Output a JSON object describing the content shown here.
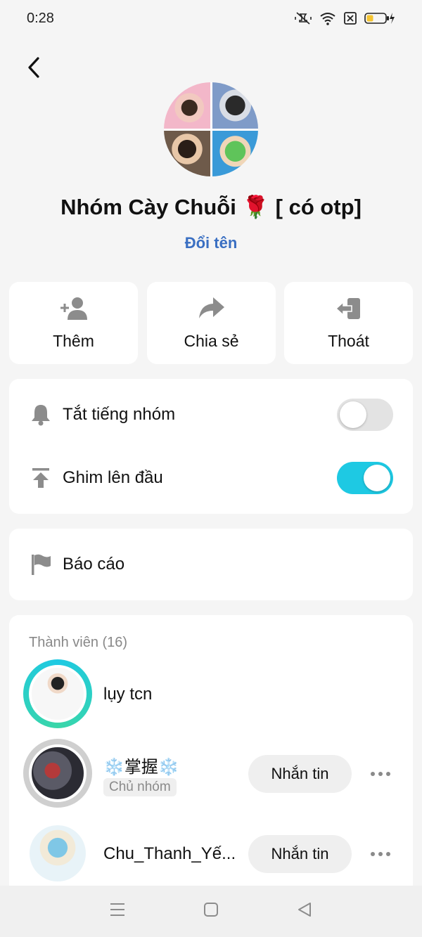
{
  "status_bar": {
    "time": "0:28"
  },
  "header": {
    "group_name": "Nhóm Cày Chuỗi 🌹 [ có otp]",
    "rename_label": "Đổi tên"
  },
  "actions": [
    {
      "label": "Thêm",
      "icon": "add-person-icon"
    },
    {
      "label": "Chia sẻ",
      "icon": "share-arrow-icon"
    },
    {
      "label": "Thoát",
      "icon": "exit-icon"
    }
  ],
  "settings": {
    "mute": {
      "label": "Tắt tiếng nhóm",
      "enabled": false
    },
    "pin": {
      "label": "Ghim lên đầu",
      "enabled": true
    }
  },
  "report": {
    "label": "Báo cáo"
  },
  "members": {
    "header": "Thành viên (16)",
    "list": [
      {
        "name": "lụy  tcn"
      },
      {
        "name": "❄️掌握❄️",
        "role": "Chủ nhóm",
        "message_label": "Nhắn tin"
      },
      {
        "name": "Chu_Thanh_Yế...",
        "message_label": "Nhắn tin"
      }
    ]
  },
  "colors": {
    "accent": "#1ec9e3",
    "link": "#3a6fc2"
  }
}
